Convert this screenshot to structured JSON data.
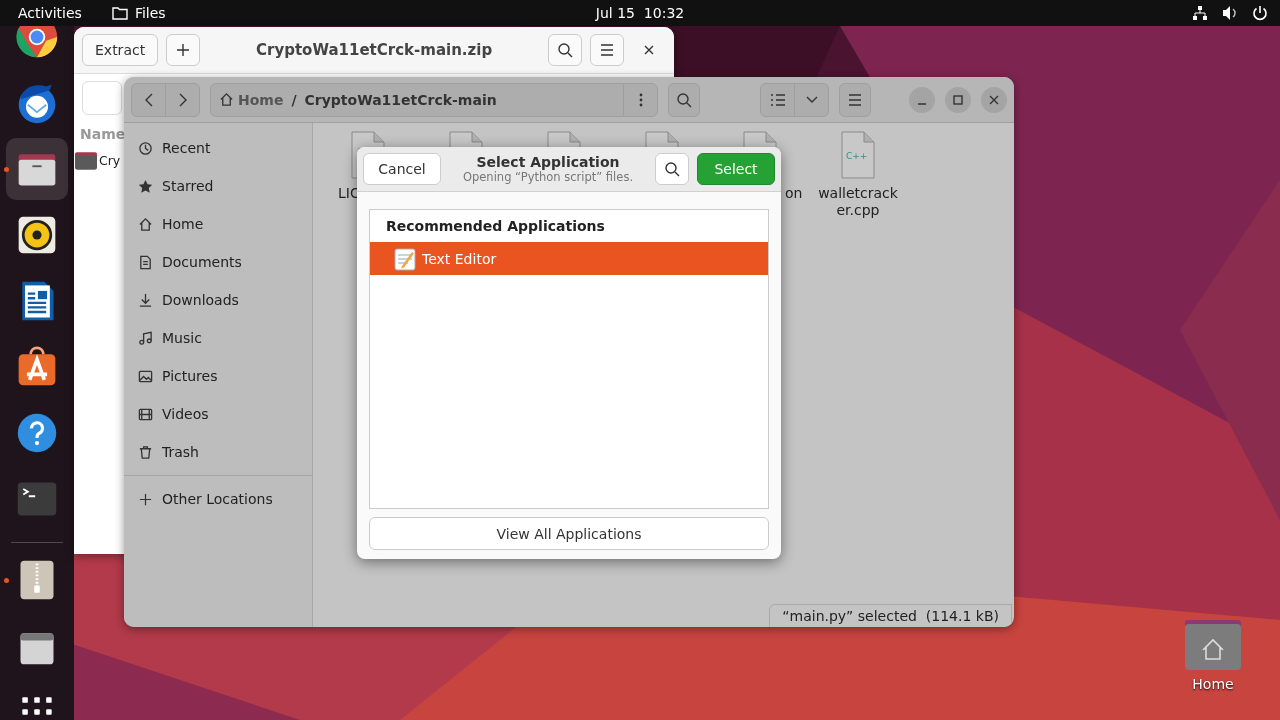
{
  "top_bar": {
    "activities": "Activities",
    "app": "Files",
    "clock": "Jul 15  10:32"
  },
  "dock": {
    "pinned": [
      {
        "kind": "browser",
        "running": false,
        "selected": false
      },
      {
        "kind": "mail",
        "running": false,
        "selected": false
      },
      {
        "kind": "files",
        "running": true,
        "selected": true
      },
      {
        "kind": "music",
        "running": false,
        "selected": false
      },
      {
        "kind": "writer",
        "running": false,
        "selected": false
      },
      {
        "kind": "store",
        "running": false,
        "selected": false
      },
      {
        "kind": "help",
        "running": false,
        "selected": false
      },
      {
        "kind": "terminal",
        "running": false,
        "selected": false
      }
    ],
    "others": [
      {
        "kind": "archive",
        "running": true,
        "selected": false
      },
      {
        "kind": "drive",
        "running": false,
        "selected": false
      },
      {
        "kind": "grid",
        "running": false,
        "selected": false
      }
    ]
  },
  "archive_window": {
    "extract": "Extract",
    "title": "CryptoWa11etCrck-main.zip",
    "column": "Name",
    "row": "Cry"
  },
  "files_window": {
    "path": [
      {
        "label": "Home"
      },
      {
        "label": "CryptoWa11etCrck-main"
      }
    ],
    "path_separator": "/",
    "sidebar": [
      {
        "kind": "recent",
        "label": "Recent"
      },
      {
        "kind": "starred",
        "label": "Starred"
      },
      {
        "kind": "home",
        "label": "Home"
      },
      {
        "kind": "documents",
        "label": "Documents"
      },
      {
        "kind": "downloads",
        "label": "Downloads"
      },
      {
        "kind": "music",
        "label": "Music"
      },
      {
        "kind": "pictures",
        "label": "Pictures"
      },
      {
        "kind": "videos",
        "label": "Videos"
      },
      {
        "kind": "trash",
        "label": "Trash"
      }
    ],
    "other_locations": "Other Locations",
    "files": [
      {
        "kind": "text",
        "name": "LIC"
      },
      {
        "kind": "text"
      },
      {
        "kind": "text"
      },
      {
        "kind": "text"
      },
      {
        "kind": "text",
        "name": "on"
      },
      {
        "kind": "code",
        "icon_text": "C++",
        "name": "walletcracker.cpp"
      }
    ],
    "status": "“main.py” selected  (114.1 kB)"
  },
  "dialog": {
    "cancel": "Cancel",
    "title": "Select Application",
    "subtitle": "Opening “Python script” files.",
    "select": "Select",
    "section": "Recommended Applications",
    "apps": [
      {
        "name": "Text Editor",
        "selected": true
      }
    ],
    "view_all": "View All Applications"
  },
  "desktop_icons": [
    {
      "label": "Home"
    }
  ]
}
